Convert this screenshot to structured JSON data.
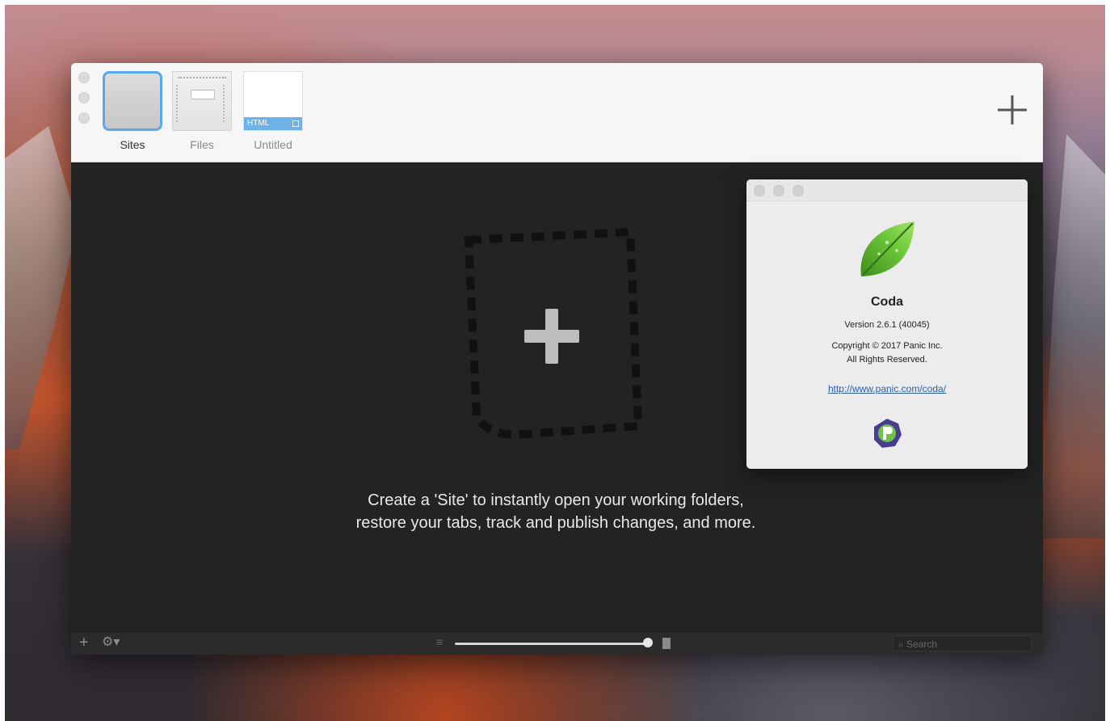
{
  "toolbar": {
    "tabs": [
      {
        "label": "Sites",
        "selected": true
      },
      {
        "label": "Files",
        "selected": false
      },
      {
        "label": "Untitled",
        "selected": false,
        "badge": "HTML"
      }
    ],
    "add_tab_icon": "plus-icon"
  },
  "content": {
    "hint_line1": "Create a 'Site' to instantly open your working folders,",
    "hint_line2": "restore your tabs, track and publish changes, and more.",
    "drop_icon": "plus-icon"
  },
  "statusbar": {
    "search_placeholder": "Search",
    "slider_level": 0.97
  },
  "about": {
    "app_name": "Coda",
    "version": "Version 2.6.1 (40045)",
    "copyright_line1": "Copyright © 2017 Panic Inc.",
    "copyright_line2": "All Rights Reserved.",
    "url": "http://www.panic.com/coda/",
    "icon": "coda-leaf-icon",
    "company_icon": "panic-logo-icon"
  },
  "colors": {
    "accent": "#5aa9ea",
    "dark_bg": "#232323",
    "link": "#2a5fb8",
    "leaf_green": "#5cb82e"
  }
}
